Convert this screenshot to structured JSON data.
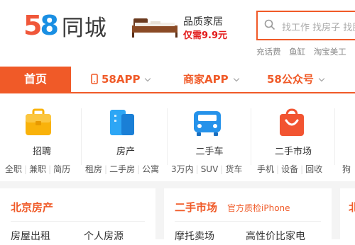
{
  "logo": {
    "digit1": "5",
    "digit2": "8",
    "text": "同城"
  },
  "promo": {
    "line1": "品质家居",
    "line2": "仅需9.9元"
  },
  "search": {
    "placeholder": "找工作 找房子 找服务"
  },
  "hot_searches": [
    "充话费",
    "鱼缸",
    "淘宝美工"
  ],
  "nav": {
    "home": "首页",
    "items": [
      {
        "label": "58APP",
        "has_phone_icon": true
      },
      {
        "label": "商家APP"
      },
      {
        "label": "58公众号"
      }
    ]
  },
  "categories": [
    {
      "label": "招聘",
      "icon": "briefcase-icon",
      "color": "#f9b20a",
      "subs": [
        "全职",
        "兼职",
        "简历"
      ]
    },
    {
      "label": "房产",
      "icon": "building-icon",
      "color": "#2da6f5",
      "subs": [
        "租房",
        "二手房",
        "公寓"
      ]
    },
    {
      "label": "二手车",
      "icon": "car-icon",
      "color": "#2592ea",
      "subs": [
        "3万内",
        "SUV",
        "货车"
      ]
    },
    {
      "label": "二手市场",
      "icon": "shopping-bag-icon",
      "color": "#f25431",
      "subs": [
        "手机",
        "设备",
        "回收"
      ]
    },
    {
      "label": "",
      "icon": "",
      "color": "",
      "subs": [
        "狗"
      ]
    }
  ],
  "panels": [
    {
      "title": "北京房产",
      "tag": "",
      "links": [
        "房屋出租",
        "个人房源"
      ]
    },
    {
      "title": "二手市场",
      "tag": "官方质检iPhone",
      "links": [
        "摩托卖场",
        "高性价比家电"
      ]
    },
    {
      "title": "北",
      "tag": "",
      "links": []
    }
  ],
  "colors": {
    "accent": "#f05a28",
    "logo_blue": "#1a8fe3"
  }
}
